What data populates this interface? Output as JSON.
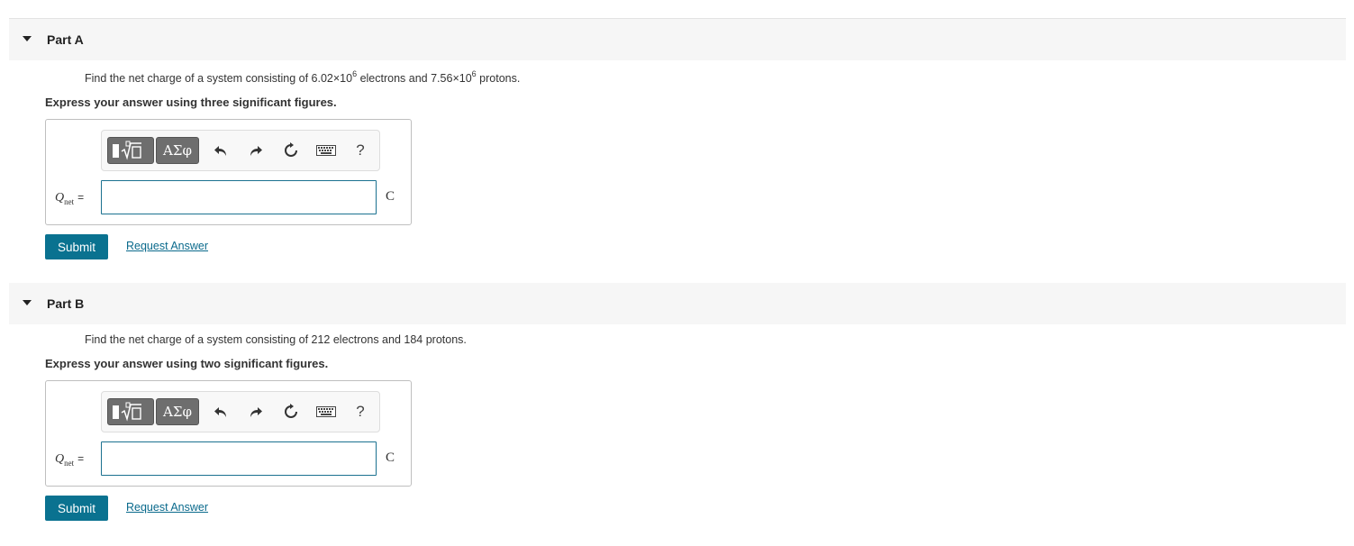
{
  "parts": [
    {
      "title": "Part A",
      "question": {
        "text_before": "Find the net charge of a system consisting of ",
        "electrons_mantissa": "6.02",
        "electrons_times": "×10",
        "electrons_exp": "6",
        "text_mid": " electrons and ",
        "protons_mantissa": "7.56",
        "protons_times": "×10",
        "protons_exp": "6",
        "text_after": " protons."
      },
      "instruction": "Express your answer using three significant figures.",
      "variable": "Q",
      "variable_sub": "net",
      "equals": "=",
      "input_value": "",
      "unit": "C",
      "submit_label": "Submit",
      "request_label": "Request Answer"
    },
    {
      "title": "Part B",
      "question_text": "Find the net charge of a system consisting of 212 electrons and 184 protons.",
      "instruction": "Express your answer using two significant figures.",
      "variable": "Q",
      "variable_sub": "net",
      "equals": "=",
      "input_value": "",
      "unit": "C",
      "submit_label": "Submit",
      "request_label": "Request Answer"
    }
  ],
  "toolbar": {
    "symbols_label": "ΑΣφ",
    "help_label": "?",
    "icons": [
      "templates-icon",
      "greek-symbols-icon",
      "undo-icon",
      "redo-icon",
      "reset-icon",
      "keyboard-icon",
      "help-icon"
    ]
  },
  "colors": {
    "accent": "#0a7290",
    "header_bg": "#f6f6f6",
    "input_border": "#1b7190",
    "toolbar_dark": "#6e6e6e"
  }
}
